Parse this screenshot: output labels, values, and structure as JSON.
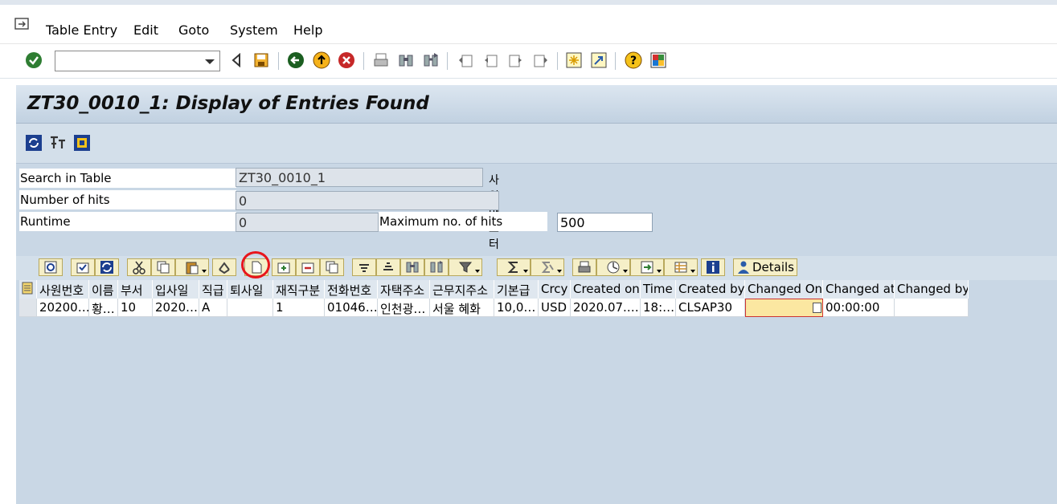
{
  "menu": [
    {
      "label": "Table Entry"
    },
    {
      "label": "Edit"
    },
    {
      "label": "Goto"
    },
    {
      "label": "System"
    },
    {
      "label": "Help"
    }
  ],
  "command_field": {
    "value": ""
  },
  "window_title": "ZT30_0010_1: Display of Entries Found",
  "form": {
    "search_label": "Search in Table",
    "search_value": "ZT30_0010_1",
    "search_desc": "사원마스터",
    "hits_label": "Number of hits",
    "hits_value": "0",
    "runtime_label": "Runtime",
    "runtime_value": "0",
    "maxhits_label": "Maximum no. of hits",
    "maxhits_value": "500"
  },
  "alv": {
    "details_label": "Details"
  },
  "grid": {
    "columns": [
      "사원번호",
      "이름",
      "부서",
      "입사일",
      "직급",
      "퇴사일",
      "재직구분",
      "전화번호",
      "자택주소",
      "근무지주소",
      "기본급",
      "Crcy",
      "Created on",
      "Time",
      "Created by",
      "Changed On",
      "Changed at",
      "Changed by"
    ],
    "rows": [
      [
        "20200…",
        "황…",
        "10",
        "2020.…",
        "A",
        "",
        "1",
        "01046…",
        "인천광…",
        "서울 혜화",
        "10,0…",
        "USD",
        "2020.07.…",
        "18:…",
        "CLSAP30",
        "",
        "00:00:00",
        ""
      ]
    ]
  },
  "colors": {
    "main_bg": "#c9d7e5",
    "title_bg": "#dce6f0",
    "highlight": "#e8161c",
    "button_bg": "#f5efc8"
  }
}
